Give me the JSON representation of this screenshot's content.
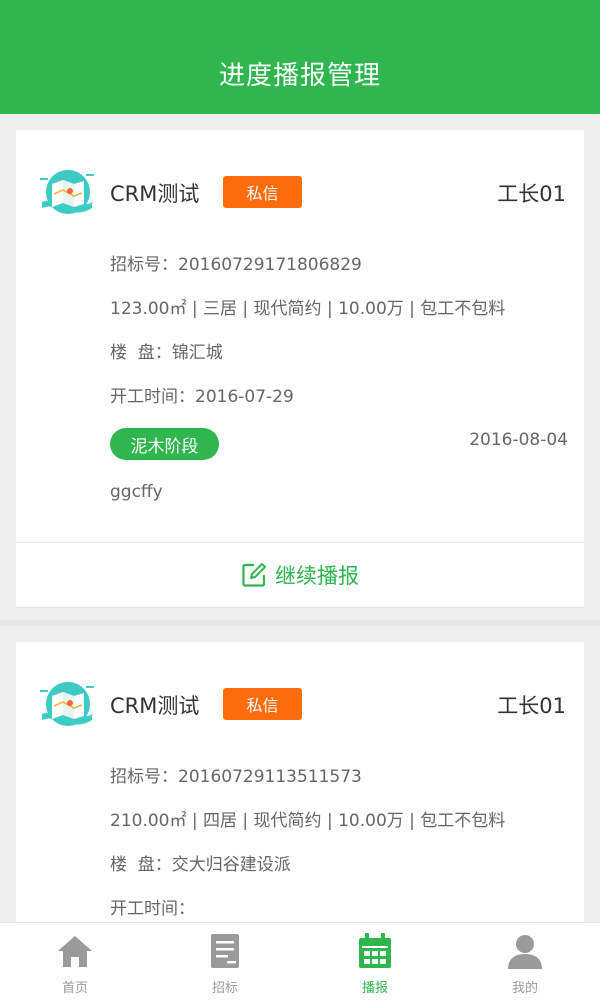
{
  "header": {
    "title": "进度播报管理"
  },
  "cards": [
    {
      "name": "CRM测试",
      "badge": "私信",
      "worker": "工长01",
      "bid_no": "招标号：20160729171806829",
      "specs": "123.00㎡ | 三居 | 现代简约 | 10.00万 | 包工不包料",
      "estate": "楼  盘：锦汇城",
      "start": "开工时间：2016-07-29",
      "stage": "泥木阶段",
      "date": "2016-08-04",
      "note": "ggcffy",
      "action": "继续播报"
    },
    {
      "name": "CRM测试",
      "badge": "私信",
      "worker": "工长01",
      "bid_no": "招标号：20160729113511573",
      "specs": "210.00㎡ | 四居 | 现代简约 | 10.00万 | 包工不包料",
      "estate": "楼  盘：交大归谷建设派",
      "start": "开工时间："
    }
  ],
  "tabs": [
    {
      "label": "首页",
      "icon": "home-icon"
    },
    {
      "label": "招标",
      "icon": "document-icon"
    },
    {
      "label": "播报",
      "icon": "calendar-icon",
      "active": true
    },
    {
      "label": "我的",
      "icon": "user-icon"
    }
  ],
  "colors": {
    "brand": "#2fb64f",
    "badge": "#fd6c0d",
    "tab_inactive": "#9a9a9a"
  }
}
